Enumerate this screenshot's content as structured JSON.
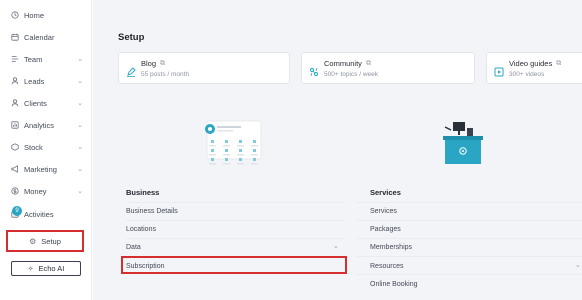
{
  "sidebar": {
    "items": [
      {
        "label": "Home",
        "icon": "clock-icon",
        "chevron": false
      },
      {
        "label": "Calendar",
        "icon": "calendar-icon",
        "chevron": false
      },
      {
        "label": "Team",
        "icon": "team-icon",
        "chevron": true
      },
      {
        "label": "Leads",
        "icon": "leads-icon",
        "chevron": true
      },
      {
        "label": "Clients",
        "icon": "user-icon",
        "chevron": true
      },
      {
        "label": "Analytics",
        "icon": "analytics-icon",
        "chevron": true
      },
      {
        "label": "Stock",
        "icon": "box-icon",
        "chevron": true
      },
      {
        "label": "Marketing",
        "icon": "megaphone-icon",
        "chevron": true
      },
      {
        "label": "Money",
        "icon": "money-icon",
        "chevron": true
      },
      {
        "label": "Activities",
        "icon": "activities-icon",
        "chevron": false
      }
    ],
    "activities_badge": "9",
    "setup_label": "Setup",
    "echo_label": "Echo AI"
  },
  "main": {
    "title": "Setup",
    "cards": [
      {
        "title": "Blog",
        "subtitle": "55 posts / month"
      },
      {
        "title": "Community",
        "subtitle": "500+ topics / week"
      },
      {
        "title": "Video guides",
        "subtitle": "300+ videos"
      }
    ],
    "business": {
      "heading": "Business",
      "rows": [
        "Business Details",
        "Locations",
        "Data",
        "Subscription"
      ]
    },
    "services": {
      "heading": "Services",
      "rows": [
        "Services",
        "Packages",
        "Memberships",
        "Resources",
        "Online Booking"
      ]
    }
  },
  "colors": {
    "accent": "#2aa6c4",
    "highlight_border": "#d62e2e",
    "background": "#f3f4f7"
  }
}
